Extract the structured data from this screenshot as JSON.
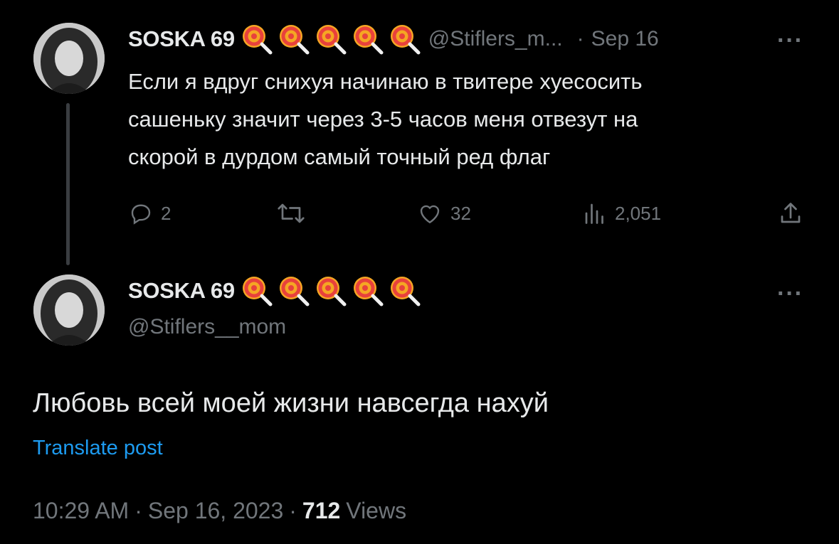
{
  "icons": {
    "avatar": "avatar-photo",
    "name_emoji": "lollipop-emoji",
    "reply": "reply-icon",
    "retweet": "retweet-icon",
    "like": "heart-icon",
    "views": "views-chart-icon",
    "share": "share-icon",
    "more": "more-icon"
  },
  "colors": {
    "background": "#000000",
    "text": "#e7e9ea",
    "muted": "#71767b",
    "link": "#1d9bf0"
  },
  "parent_tweet": {
    "display_name": "SOSKA 69",
    "handle": "@Stiflers_m...",
    "separator": "·",
    "date": "Sep 16",
    "more": "···",
    "lines": [
      "Если я вдруг снихуя начинаю в твитере хуесосить",
      "сашеньку значит через 3-5 часов меня отвезут на",
      "скорой в дурдом самый точный ред флаг"
    ],
    "replies": "2",
    "likes": "32",
    "views": "2,051"
  },
  "main_tweet": {
    "display_name": "SOSKA 69",
    "handle": "@Stiflers__mom",
    "more": "···",
    "text": "Любовь всей моей жизни навсегда нахуй",
    "translate": "Translate post",
    "time": "10:29 AM",
    "dot1": "·",
    "date": "Sep 16, 2023",
    "dot2": "·",
    "views_count": "712",
    "views_label": "Views"
  }
}
